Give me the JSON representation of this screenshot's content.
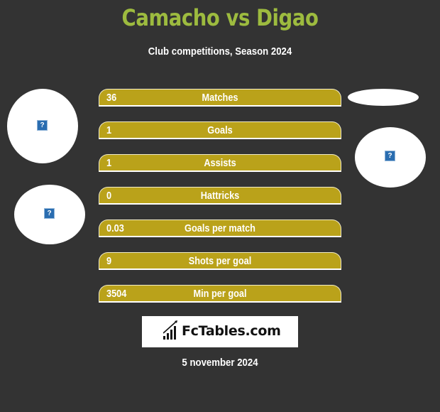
{
  "header": {
    "title": "Camacho vs Digao",
    "subtitle": "Club competitions, Season 2024"
  },
  "colors": {
    "background": "#333333",
    "title": "#9dbb3f",
    "bar": "#baa21a",
    "text": "#ffffff"
  },
  "players": {
    "left": {
      "name": "Camacho",
      "image_icon": "broken-image-icon"
    },
    "right": {
      "name": "Digao",
      "image_icon": "broken-image-icon"
    }
  },
  "stats": [
    {
      "value": "36",
      "label": "Matches"
    },
    {
      "value": "1",
      "label": "Goals"
    },
    {
      "value": "1",
      "label": "Assists"
    },
    {
      "value": "0",
      "label": "Hattricks"
    },
    {
      "value": "0.03",
      "label": "Goals per match"
    },
    {
      "value": "9",
      "label": "Shots per goal"
    },
    {
      "value": "3504",
      "label": "Min per goal"
    }
  ],
  "logo": {
    "text": "FcTables.com",
    "icon": "bar-chart-icon"
  },
  "footer": {
    "date": "5 november 2024"
  },
  "icons": {
    "placeholder_glyph": "?"
  }
}
